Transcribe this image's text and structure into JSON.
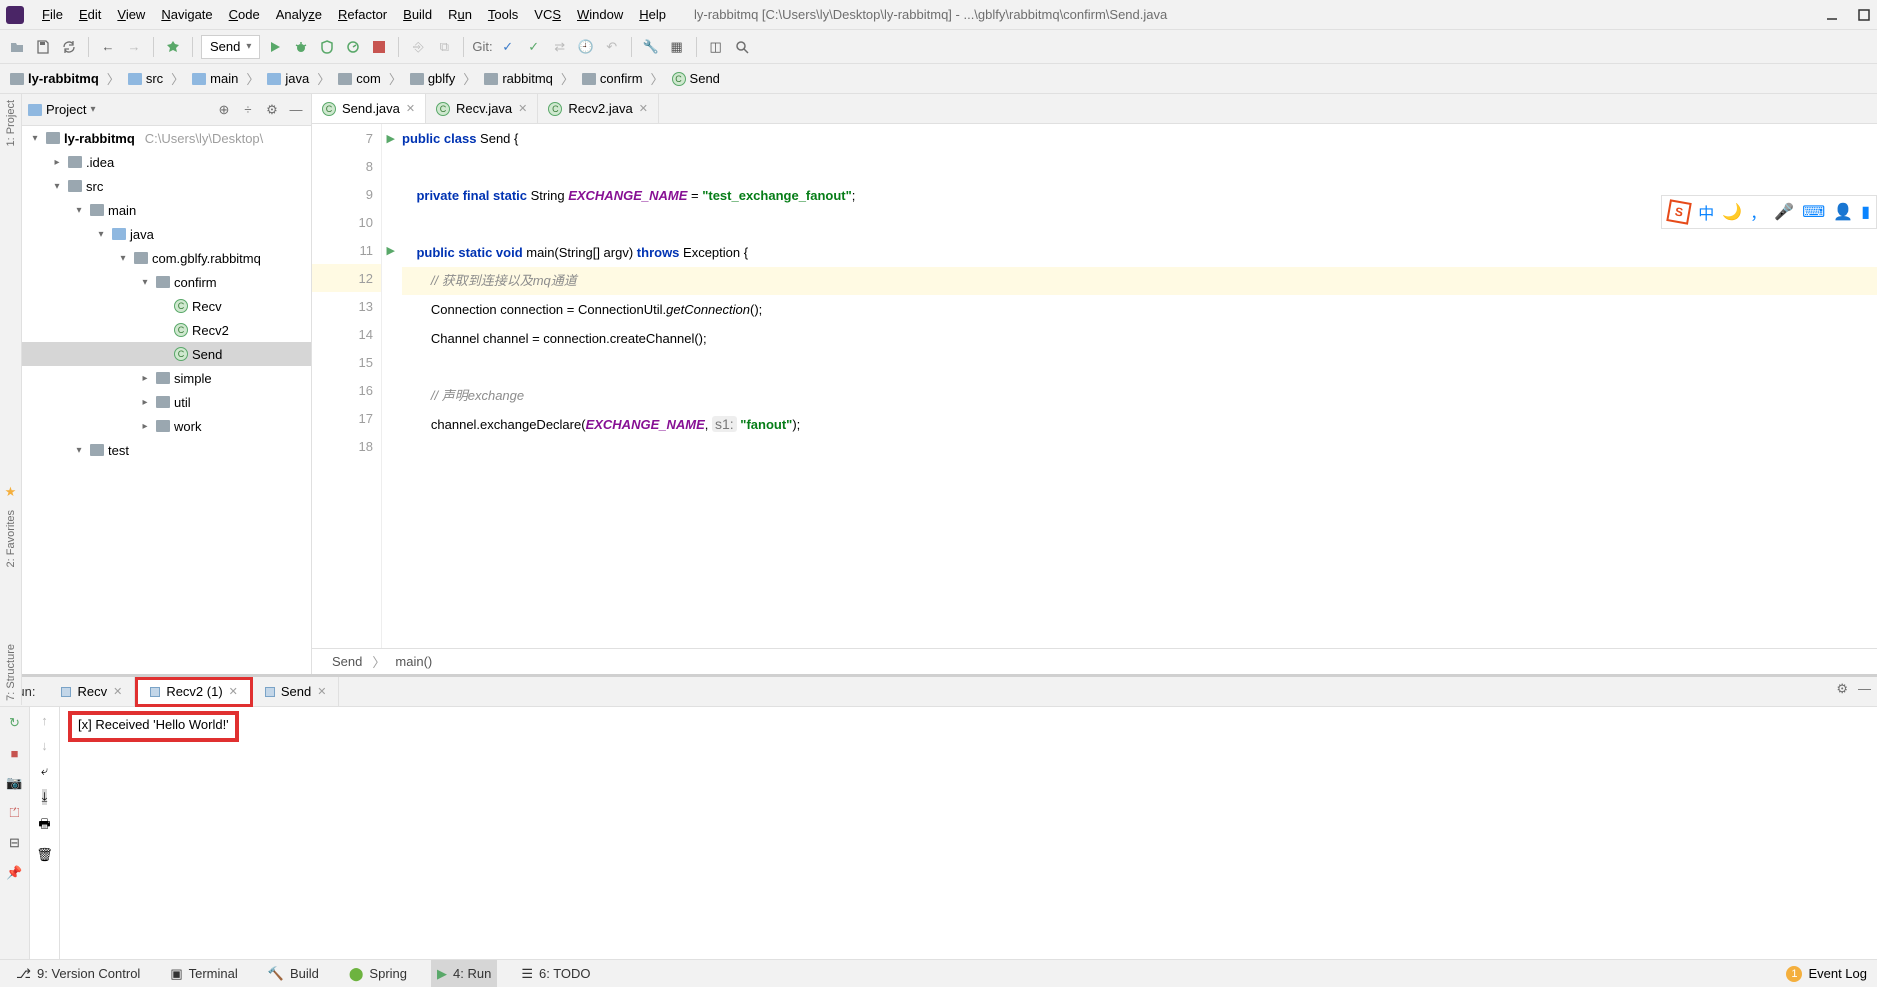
{
  "menu": {
    "items": [
      "File",
      "Edit",
      "View",
      "Navigate",
      "Code",
      "Analyze",
      "Refactor",
      "Build",
      "Run",
      "Tools",
      "VCS",
      "Window",
      "Help"
    ]
  },
  "window_title": "ly-rabbitmq [C:\\Users\\ly\\Desktop\\ly-rabbitmq] - ...\\gblfy\\rabbitmq\\confirm\\Send.java",
  "run_config": "Send",
  "git_label": "Git:",
  "breadcrumbs": [
    "ly-rabbitmq",
    "src",
    "main",
    "java",
    "com",
    "gblfy",
    "rabbitmq",
    "confirm",
    "Send"
  ],
  "project_panel": {
    "title": "Project"
  },
  "tree": {
    "root": {
      "name": "ly-rabbitmq",
      "path": "C:\\Users\\ly\\Desktop\\"
    },
    "idea": ".idea",
    "src": "src",
    "main": "main",
    "java": "java",
    "pkg": "com.gblfy.rabbitmq",
    "confirm": "confirm",
    "recv": "Recv",
    "recv2": "Recv2",
    "send": "Send",
    "simple": "simple",
    "util": "util",
    "work": "work",
    "test": "test"
  },
  "editor_tabs": [
    {
      "name": "Send.java",
      "active": true
    },
    {
      "name": "Recv.java",
      "active": false
    },
    {
      "name": "Recv2.java",
      "active": false
    }
  ],
  "code": {
    "lines": [
      "7",
      "8",
      "9",
      "10",
      "11",
      "12",
      "13",
      "14",
      "15",
      "16",
      "17",
      "18"
    ],
    "l7a": "public class ",
    "l7b": "Send {",
    "l9a": "    private final static ",
    "l9b": "String ",
    "l9c": "EXCHANGE_NAME",
    "l9d": " = ",
    "l9e": "\"test_exchange_fanout\"",
    "l9f": ";",
    "l11a": "    public static void ",
    "l11b": "main(String[] argv) ",
    "l11c": "throws ",
    "l11d": "Exception {",
    "l12": "        // 获取到连接以及mq通道",
    "l13a": "        Connection connection = ConnectionUtil.",
    "l13b": "getConnection",
    "l13c": "();",
    "l14": "        Channel channel = connection.createChannel();",
    "l16": "        // 声明exchange",
    "l17a": "        channel.exchangeDeclare(",
    "l17b": "EXCHANGE_NAME",
    "l17c": ", ",
    "l17d": "s1:",
    "l17e": " \"fanout\"",
    "l17f": ");"
  },
  "bottom_crumb": {
    "a": "Send",
    "b": "main()"
  },
  "run_panel": {
    "label": "Run:",
    "tabs": [
      {
        "name": "Recv",
        "active": false
      },
      {
        "name": "Recv2 (1)",
        "active": true
      },
      {
        "name": "Send",
        "active": false
      }
    ],
    "output": "[x] Received 'Hello World!'"
  },
  "left_rail": {
    "a": "1: Project",
    "b": "2: Favorites",
    "c": "7: Structure"
  },
  "statusbar": {
    "vc": "9: Version Control",
    "terminal": "Terminal",
    "build": "Build",
    "spring": "Spring",
    "run": "4: Run",
    "todo": "6: TODO",
    "eventlog": "Event Log"
  },
  "ime": {
    "zh": "中"
  }
}
